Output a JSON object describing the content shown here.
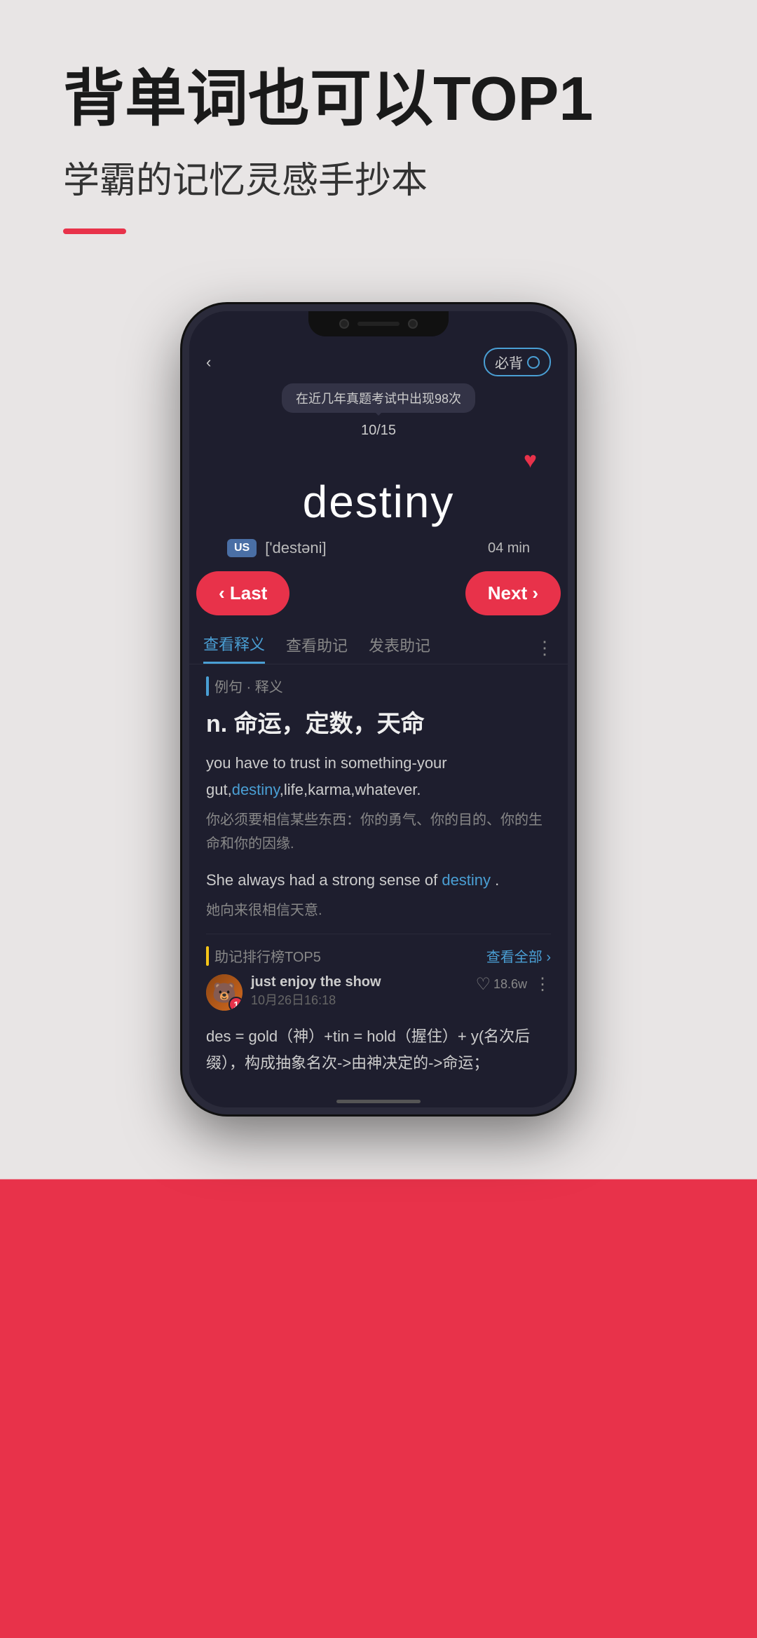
{
  "hero": {
    "title_part1": "背单词也可以",
    "title_bold": "TOP1",
    "subtitle": "学霸的记忆灵感手抄本"
  },
  "phone": {
    "topbar": {
      "back_icon": "‹",
      "badge_label": "必背",
      "badge_icon": "○"
    },
    "tooltip": {
      "text": "在近几年真题考试中出现98次",
      "counter": "10/15"
    },
    "word": {
      "title": "destiny",
      "phonetic_badge": "US",
      "phonetic": "['destəni]",
      "time": "04  min"
    },
    "nav": {
      "last_label": "‹ Last",
      "next_label": "Next ›"
    },
    "tabs": [
      {
        "label": "查看释义",
        "active": true
      },
      {
        "label": "查看助记",
        "active": false
      },
      {
        "label": "发表助记",
        "active": false
      }
    ],
    "content": {
      "section_label": "例句 · 释义",
      "definition": "n. 命运，定数，天命",
      "examples": [
        {
          "en": "you have to trust in something-your gut,destiny,life,karma,whatever.",
          "cn": "你必须要相信某些东西：你的勇气、你的目的、你的生命和你的因缘.",
          "highlight_word": "destiny"
        },
        {
          "en": "She always had a strong sense of destiny .",
          "cn": "她向来很相信天意.",
          "highlight_word": "destiny"
        }
      ]
    },
    "mnemonic": {
      "title": "助记排行榜TOP5",
      "view_all": "查看全部 ›",
      "card": {
        "user": "just enjoy the show",
        "date": "10月26日16:18",
        "likes": "18.6w",
        "text": "des = gold（神）+tin = hold（握住）+ y(名次后缀），构成抽象名次->由神决定的->命运；"
      }
    }
  }
}
